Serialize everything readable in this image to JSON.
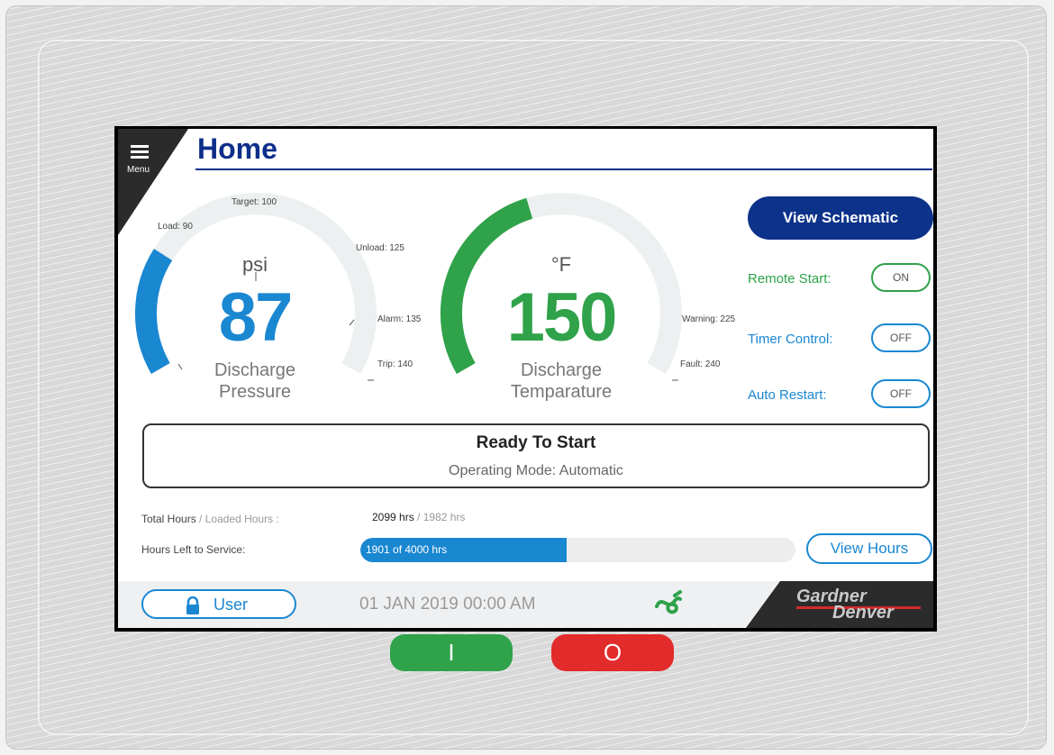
{
  "menu": {
    "label": "Menu"
  },
  "header": {
    "title": "Home"
  },
  "pressure_gauge": {
    "unit": "psi",
    "value": "87",
    "name_line1": "Discharge",
    "name_line2": "Pressure",
    "color": "#1a87d1",
    "fill_fraction": 0.26,
    "markers": {
      "load": "Load: 90",
      "target": "Target: 100",
      "unload": "Unload: 125",
      "alarm": "Alarm: 135",
      "trip": "Trip: 140"
    }
  },
  "temperature_gauge": {
    "unit": "°F",
    "value": "150",
    "name_line1": "Discharge",
    "name_line2": "Temparature",
    "color": "#2fa24a",
    "fill_fraction": 0.43,
    "markers": {
      "warning": "Warning: 225",
      "fault": "Fault: 240"
    }
  },
  "controls": {
    "view_schematic": "View Schematic",
    "remote_start": {
      "label": "Remote Start:",
      "state": "ON"
    },
    "timer_control": {
      "label": "Timer Control:",
      "state": "OFF"
    },
    "auto_restart": {
      "label": "Auto Restart:",
      "state": "OFF"
    }
  },
  "status": {
    "title": "Ready To Start",
    "mode": "Operating Mode: Automatic"
  },
  "hours": {
    "total_label": "Total Hours",
    "separator": " / ",
    "loaded_label": "Loaded Hours :",
    "total_value": "2099 hrs",
    "loaded_value": "1982 hrs",
    "service_label": "Hours Left to Service:",
    "service_text": "1901 of 4000 hrs",
    "service_fraction": 0.475,
    "view_hours": "View Hours"
  },
  "footer": {
    "user_label": "User",
    "datetime": "01 JAN 2019 00:00 AM",
    "brand_line1": "Gardner",
    "brand_line2": "Denver"
  },
  "hardware": {
    "start_symbol": "I",
    "stop_symbol": "O"
  },
  "colors": {
    "accent_blue": "#0d3289",
    "info_blue": "#1a87d1",
    "green": "#2fa24a",
    "red": "#e22b2b"
  }
}
